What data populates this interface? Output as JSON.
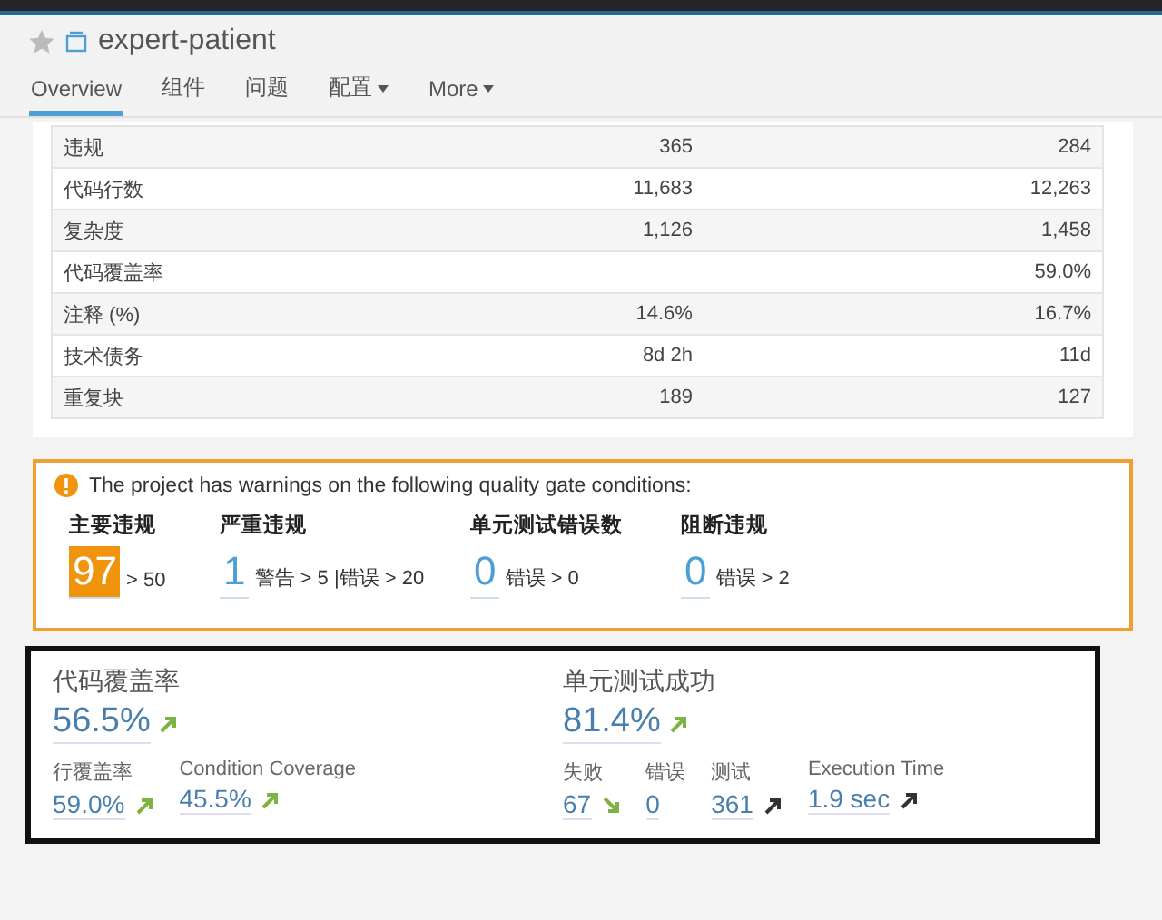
{
  "project": {
    "title": "expert-patient",
    "favorite": false
  },
  "tabs": [
    {
      "label": "Overview",
      "selected": true,
      "dropdown": false
    },
    {
      "label": "组件",
      "selected": false,
      "dropdown": false
    },
    {
      "label": "问题",
      "selected": false,
      "dropdown": false
    },
    {
      "label": "配置",
      "selected": false,
      "dropdown": true
    },
    {
      "label": "More",
      "selected": false,
      "dropdown": true
    }
  ],
  "table": {
    "rows": [
      {
        "name": "违规",
        "column_2": "365",
        "column_3": "284"
      },
      {
        "name": "代码行数",
        "column_2": "11,683",
        "column_3": "12,263"
      },
      {
        "name": "复杂度",
        "column_2": "1,126",
        "column_3": "1,458"
      },
      {
        "name": "代码覆盖率",
        "column_2": "",
        "column_3": "59.0%"
      },
      {
        "name": "注释 (%)",
        "column_2": "14.6%",
        "column_3": "16.7%"
      },
      {
        "name": "技术债务",
        "column_2": "8d 2h",
        "column_3": "11d"
      },
      {
        "name": "重复块",
        "column_2": "189",
        "column_3": "127"
      }
    ]
  },
  "quality_gate": {
    "message": "The project has warnings on the following quality gate conditions:",
    "conditions": [
      {
        "label": "主要违规",
        "value": "97",
        "threshold": "> 50",
        "failed": true
      },
      {
        "label": "严重违规",
        "value": "1",
        "threshold": "警告 > 5 |错误 > 20",
        "failed": false
      },
      {
        "label": "单元测试错误数",
        "value": "0",
        "threshold": "错误 > 0",
        "failed": false
      },
      {
        "label": "阻断违规",
        "value": "0",
        "threshold": "错误 > 2",
        "failed": false
      }
    ]
  },
  "measures": [
    {
      "title": "代码覆盖率",
      "value": "56.5%",
      "kind": "up",
      "color": "#7cb342",
      "details": [
        {
          "label": "行覆盖率",
          "value": "59.0%",
          "kind": "up",
          "color": "#7cb342"
        },
        {
          "label": "Condition Coverage",
          "value": "45.5%",
          "kind": "up",
          "color": "#7cb342"
        }
      ]
    },
    {
      "title": "单元测试成功",
      "value": "81.4%",
      "kind": "up",
      "color": "#7cb342",
      "details": [
        {
          "label": "失败",
          "value": "67",
          "kind": "down",
          "color": "#7cb342"
        },
        {
          "label": "错误",
          "value": "0",
          "kind": "none"
        },
        {
          "label": "测试",
          "value": "361",
          "kind": "up",
          "color": "#333333"
        },
        {
          "label": "Execution Time",
          "value": "1.9 sec",
          "kind": "up",
          "color": "#333333"
        }
      ]
    }
  ]
}
